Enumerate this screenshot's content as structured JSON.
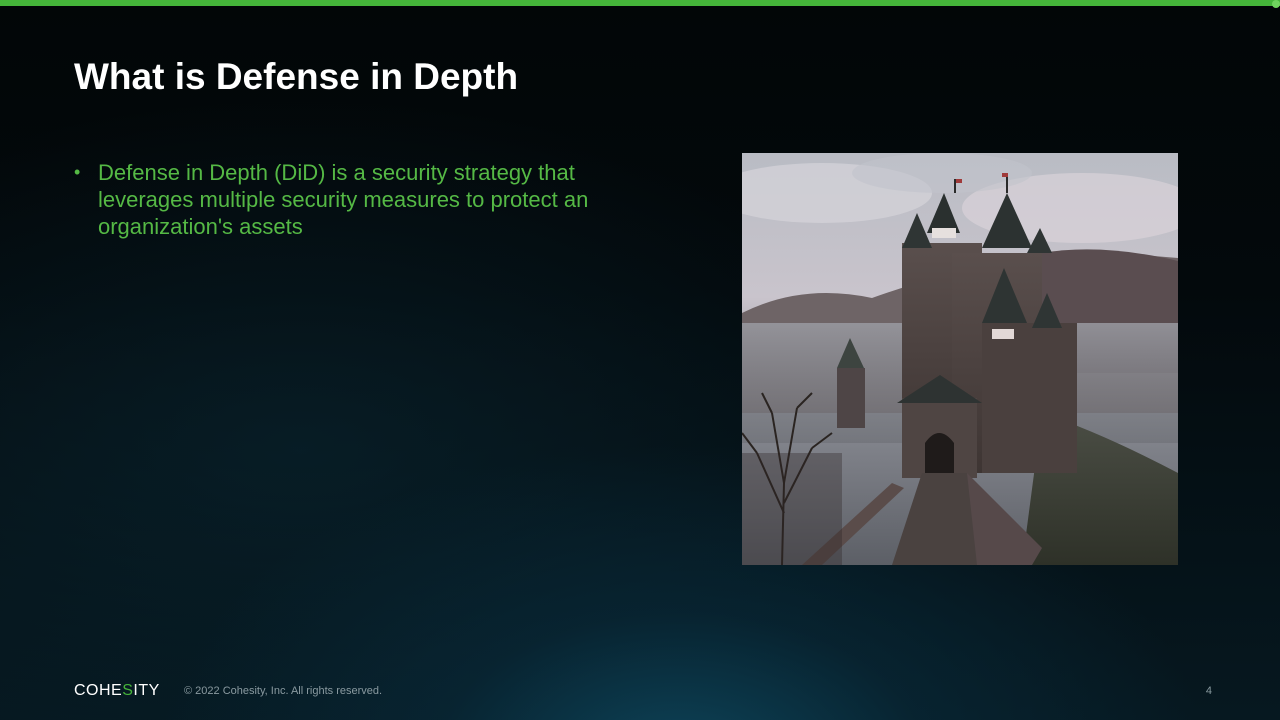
{
  "slide": {
    "title": "What is Defense in Depth",
    "bullets": [
      {
        "marker": "•",
        "text": "Defense in Depth (DiD) is a security strategy that leverages multiple security measures to protect an organization's assets"
      }
    ],
    "image": {
      "subject": "castle-photo",
      "icon": "castle-image"
    }
  },
  "footer": {
    "logo_part1": "COHE",
    "logo_accent": "S",
    "logo_part2": "ITY",
    "copyright": "© 2022 Cohesity, Inc. All rights reserved.",
    "page_number": "4"
  },
  "colors": {
    "accent": "#45b53a",
    "bullet_text": "#55b945",
    "title": "#ffffff",
    "background_top": "#020607",
    "background_bottom": "#061820"
  }
}
